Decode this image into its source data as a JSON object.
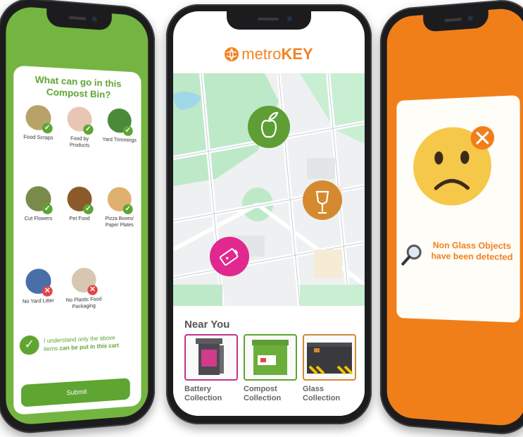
{
  "left_screen": {
    "title": "What can go in this Compost Bin?",
    "items": [
      {
        "label": "Food Scraps",
        "status": "allowed",
        "color": "#b7a36a"
      },
      {
        "label": "Food by Products",
        "status": "allowed",
        "color": "#e7c6b4"
      },
      {
        "label": "Yard Trimmings",
        "status": "allowed",
        "color": "#4a8b3a"
      },
      {
        "label": "Cut Flowers",
        "status": "allowed",
        "color": "#7a8a4a"
      },
      {
        "label": "Pet Food",
        "status": "allowed",
        "color": "#8b5a2b"
      },
      {
        "label": "Pizza Boxes/ Paper Plates",
        "status": "allowed",
        "color": "#e0b070"
      },
      {
        "label": "No Yard Litter",
        "status": "not-allowed",
        "color": "#4a6fa8"
      },
      {
        "label": "No Plastic Food Packaging",
        "status": "not-allowed",
        "color": "#d8c7b0"
      }
    ],
    "agree_text_line1": "I understand only the above",
    "agree_text_line2a": "items",
    "agree_text_line2b": "can be put in this cart",
    "submit_label": "Submit"
  },
  "center_screen": {
    "brand_light": "metro",
    "brand_bold": "KEY",
    "brand_color": "#f08423",
    "map_pins": [
      {
        "name": "compost",
        "icon": "apple-leaf-icon",
        "color": "#5e9e34"
      },
      {
        "name": "glass",
        "icon": "broken-glass-icon",
        "color": "#d58a2f"
      },
      {
        "name": "battery",
        "icon": "battery-icon",
        "color": "#e0288e"
      }
    ],
    "near_title": "Near You",
    "collections": [
      {
        "label_line1": "Battery",
        "label_line2": "Collection",
        "border": "#c0338d"
      },
      {
        "label_line1": "Compost",
        "label_line2": "Collection",
        "border": "#5ea531"
      },
      {
        "label_line1": "Glass",
        "label_line2": "Collection",
        "border": "#d08a35"
      }
    ]
  },
  "right_screen": {
    "message_line1": "Non Glass Objects",
    "message_line2": "have been detected",
    "accent": "#f07f1a"
  }
}
